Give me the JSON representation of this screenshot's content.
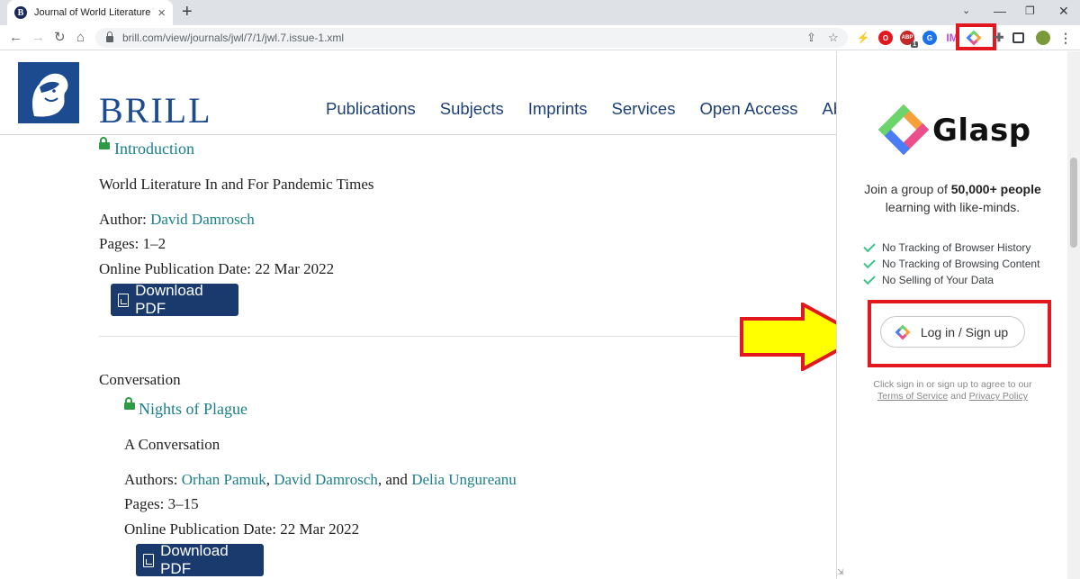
{
  "browser": {
    "tab_title": "Journal of World Literature Volum",
    "tab_favicon": "B",
    "url": "brill.com/view/journals/jwl/7/1/jwl.7.issue-1.xml",
    "extension_badge": "1"
  },
  "site": {
    "brand": "BRILL",
    "nav": [
      "Publications",
      "Subjects",
      "Imprints",
      "Services",
      "Open Access",
      "Ab"
    ]
  },
  "articles": [
    {
      "section": "",
      "title": "Introduction",
      "subtitle": "World Literature In and For Pandemic Times",
      "authors_label": "Author:",
      "authors": [
        "David Damrosch"
      ],
      "pages_label": "Pages:",
      "pages": "1–2",
      "date_label": "Online Publication Date:",
      "date": "22 Mar 2022",
      "download_label": "Download PDF"
    },
    {
      "section": "Conversation",
      "title": "Nights of Plague",
      "subtitle": "A Conversation",
      "authors_label": "Authors:",
      "authors": [
        "Orhan Pamuk",
        "David Damrosch",
        "Delia Ungureanu"
      ],
      "author_sep_1": ",",
      "author_sep_2": ", and",
      "pages_label": "Pages:",
      "pages": "3–15",
      "date_label": "Online Publication Date:",
      "date": "22 Mar 2022",
      "download_label": "Download PDF"
    }
  ],
  "glasp": {
    "brand": "Glasp",
    "join_prefix": "Join a group of",
    "join_bold": "50,000+ people",
    "join_suffix": "learning with like-minds.",
    "features": [
      "No Tracking of Browser History",
      "No Tracking of Browsing Content",
      "No Selling of Your Data"
    ],
    "login_label": "Log in / Sign up",
    "terms_line1": "Click sign in or sign up to agree to our",
    "terms_link": "Terms of Service",
    "terms_and": "and",
    "privacy_link": "Privacy Policy"
  },
  "colors": {
    "brill_blue": "#1c4b90",
    "link_teal": "#1a7f8a",
    "button_navy": "#1a3a6e",
    "highlight_red": "#e3171e",
    "arrow_yellow": "#ffff00",
    "check_green": "#3cc389"
  }
}
